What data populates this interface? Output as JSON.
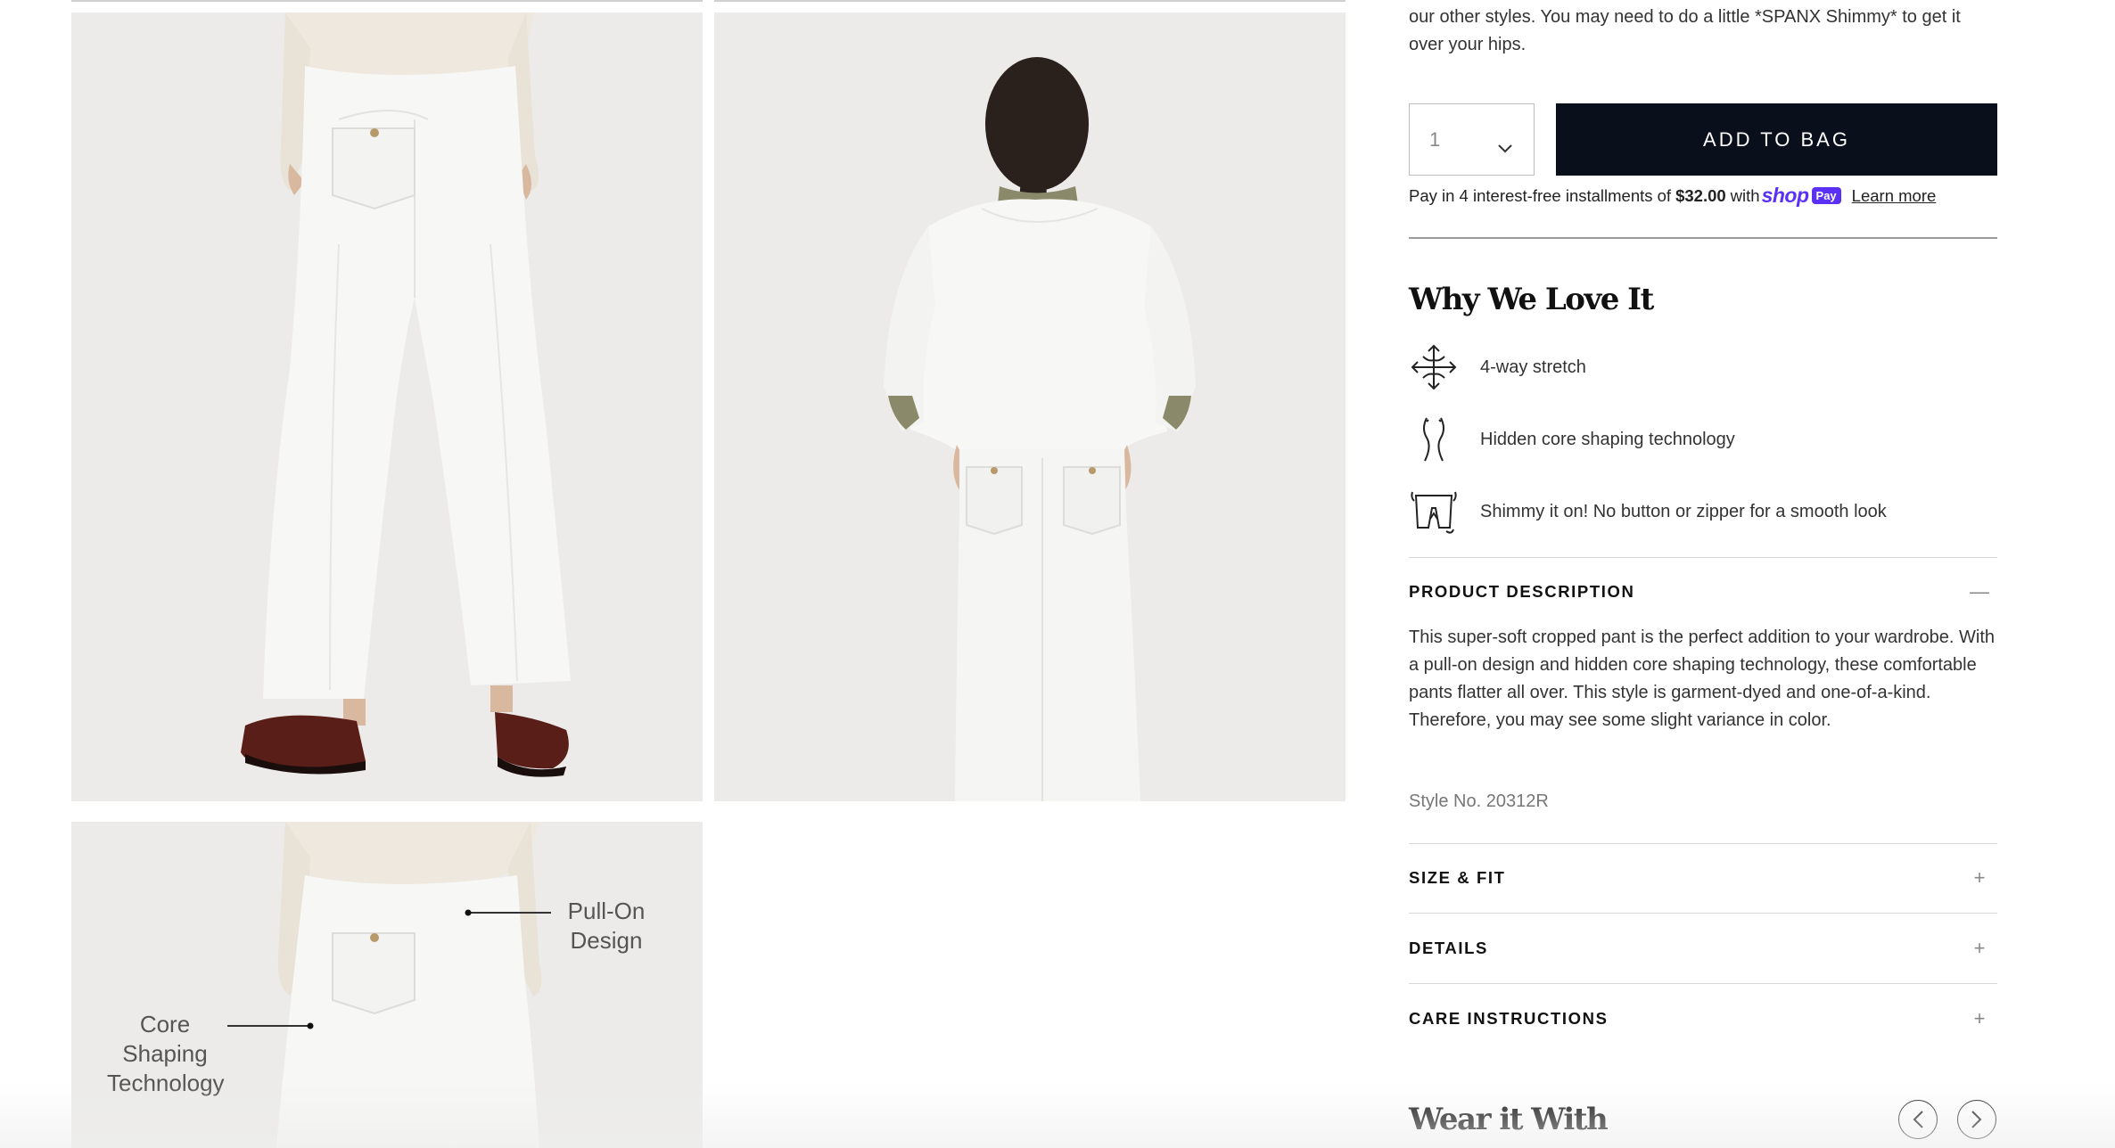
{
  "product": {
    "intro_text": "our other styles. You may need to do a little *SPANX Shimmy* to get it over your hips.",
    "quantity": "1",
    "add_to_bag": "ADD TO BAG",
    "shoppay": {
      "prefix": "Pay in 4 interest-free installments of",
      "amount": "$32.00",
      "with": "with",
      "logo_word": "shop",
      "logo_pill": "Pay",
      "learn_more": "Learn more"
    }
  },
  "gallery": {
    "callouts": {
      "pull_on": "Pull-On\nDesign",
      "core": "Core\nShaping\nTechnology"
    }
  },
  "why": {
    "title": "Why We Love It",
    "features": [
      {
        "icon": "four-way-arrows-icon",
        "label": "4-way stretch"
      },
      {
        "icon": "waist-curves-icon",
        "label": "Hidden core shaping technology"
      },
      {
        "icon": "shimmy-pants-icon",
        "label": "Shimmy it on! No button or zipper for a smooth look"
      }
    ]
  },
  "accordion": {
    "description": {
      "label": "PRODUCT DESCRIPTION",
      "sign": "—",
      "text": "This super-soft cropped pant is the perfect addition to your wardrobe. With a pull-on design and hidden core shaping technology, these comfortable pants flatter all over. This style is garment-dyed and one-of-a-kind. Therefore, you may see some slight variance in color.",
      "style_no": "Style No. 20312R"
    },
    "size_fit": {
      "label": "SIZE & FIT",
      "sign": "+"
    },
    "details": {
      "label": "DETAILS",
      "sign": "+"
    },
    "care": {
      "label": "CARE INSTRUCTIONS",
      "sign": "+"
    }
  },
  "wear_with": {
    "title": "Wear it With"
  }
}
